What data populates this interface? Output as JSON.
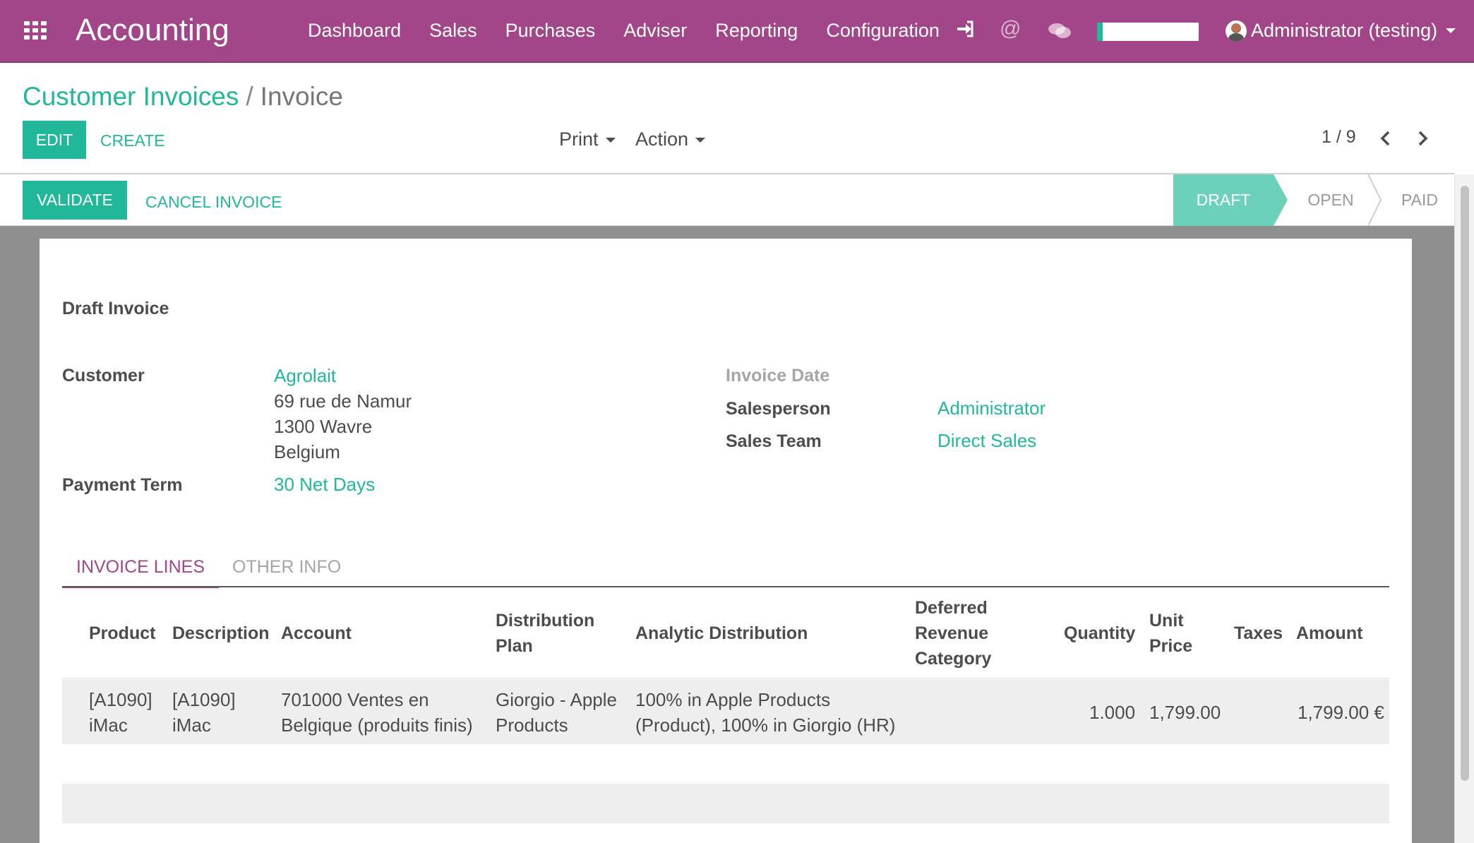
{
  "navbar": {
    "brand": "Accounting",
    "menu": [
      "Dashboard",
      "Sales",
      "Purchases",
      "Adviser",
      "Reporting",
      "Configuration"
    ],
    "user": "Administrator (testing)",
    "icons": [
      "apps-grid-icon",
      "sign-in-icon",
      "at-icon",
      "chat-icon"
    ]
  },
  "breadcrumb": {
    "parent": "Customer Invoices",
    "separator": "/",
    "current": "Invoice"
  },
  "toolbar": {
    "edit": "EDIT",
    "create": "CREATE",
    "print": "Print",
    "action": "Action",
    "pager": "1 / 9"
  },
  "statusbar": {
    "validate": "VALIDATE",
    "cancel": "CANCEL INVOICE",
    "stages": [
      "DRAFT",
      "OPEN",
      "PAID"
    ],
    "active_stage": "DRAFT"
  },
  "invoice": {
    "title": "Draft Invoice",
    "customer_label": "Customer",
    "customer_name": "Agrolait",
    "address_lines": [
      "69 rue de Namur",
      "1300 Wavre",
      "Belgium"
    ],
    "payment_term_label": "Payment Term",
    "payment_term": "30 Net Days",
    "invoice_date_label": "Invoice Date",
    "salesperson_label": "Salesperson",
    "salesperson": "Administrator",
    "sales_team_label": "Sales Team",
    "sales_team": "Direct Sales"
  },
  "tabs": [
    "INVOICE LINES",
    "OTHER INFO"
  ],
  "lines_table": {
    "headers": {
      "product": "Product",
      "description": "Description",
      "account": "Account",
      "distribution_plan": [
        "Distribution",
        "Plan"
      ],
      "analytic_distribution": "Analytic Distribution",
      "deferred_revenue": [
        "Deferred",
        "Revenue",
        "Category"
      ],
      "quantity": "Quantity",
      "unit_price": [
        "Unit",
        "Price"
      ],
      "taxes": "Taxes",
      "amount": "Amount"
    },
    "rows": [
      {
        "product": [
          "[A1090]",
          "iMac"
        ],
        "description": [
          "[A1090]",
          "iMac"
        ],
        "account": [
          "701000 Ventes en",
          "Belgique (produits finis)"
        ],
        "distribution_plan": [
          "Giorgio - Apple",
          "Products"
        ],
        "analytic_distribution": [
          "100% in Apple Products",
          "(Product), 100% in Giorgio (HR)"
        ],
        "deferred_revenue": "",
        "quantity": "1.000",
        "unit_price": "1,799.00",
        "taxes": "",
        "amount": "1,799.00 €"
      }
    ]
  },
  "colors": {
    "navbar": "#a24689",
    "accent": "#21b799",
    "active_stage": "#6cd1bb",
    "sheet_background": "#8f8f8f"
  }
}
